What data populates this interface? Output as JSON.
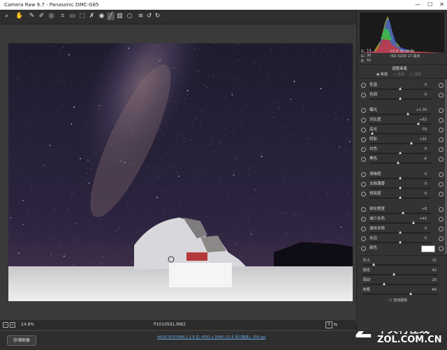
{
  "titlebar": {
    "title": "Camera Raw 9.7  -  Panasonic DMC-G85",
    "min": "—",
    "max": "☐",
    "close": "✕"
  },
  "histogram": {
    "r_label": "R：",
    "r": "14",
    "g_label": "G：",
    "g": "30",
    "b_label": "B：",
    "b": "50",
    "f_exp": "f/2.8   30.00 秒",
    "iso_lens": "ISO 3200   17 毫米"
  },
  "panel": {
    "heading": "调整画笔",
    "mode_new": "新建",
    "mode_add": "添加",
    "mode_erase": "清除",
    "sliders": [
      {
        "label": "色温",
        "value": "0"
      },
      {
        "label": "色调",
        "value": "0"
      },
      {
        "label": "曝光",
        "value": "+1.30"
      },
      {
        "label": "对比度",
        "value": "+63"
      },
      {
        "label": "高光",
        "value": "-79"
      },
      {
        "label": "阴影",
        "value": "+31"
      },
      {
        "label": "白色",
        "value": "0"
      },
      {
        "label": "黑色",
        "value": "-6"
      },
      {
        "label": "清晰度",
        "value": "0"
      },
      {
        "label": "去除薄雾",
        "value": "0"
      },
      {
        "label": "饱和度",
        "value": "0"
      },
      {
        "label": "锐化程度",
        "value": "+8"
      },
      {
        "label": "减少杂色",
        "value": "+43"
      },
      {
        "label": "波纹去除",
        "value": "0"
      },
      {
        "label": "去边",
        "value": "0"
      }
    ],
    "color_label": "颜色",
    "brush": [
      {
        "label": "大小",
        "value": "15"
      },
      {
        "label": "羽化",
        "value": "42"
      },
      {
        "label": "流动",
        "value": "29"
      },
      {
        "label": "浓度",
        "value": "64"
      }
    ],
    "automask_label": "自动蒙版"
  },
  "status": {
    "zoom": "24.8%",
    "filename": "P1010591.RW2",
    "workflow": "sRGB IEC61966-2.1 8 位; 4592 x 3448 (15.8 百万像素); 300 ppi"
  },
  "bottom": {
    "save_label": "存储图像",
    "watermark_cn": "中关村在线",
    "watermark_en": "ZOL.COM.CN"
  }
}
